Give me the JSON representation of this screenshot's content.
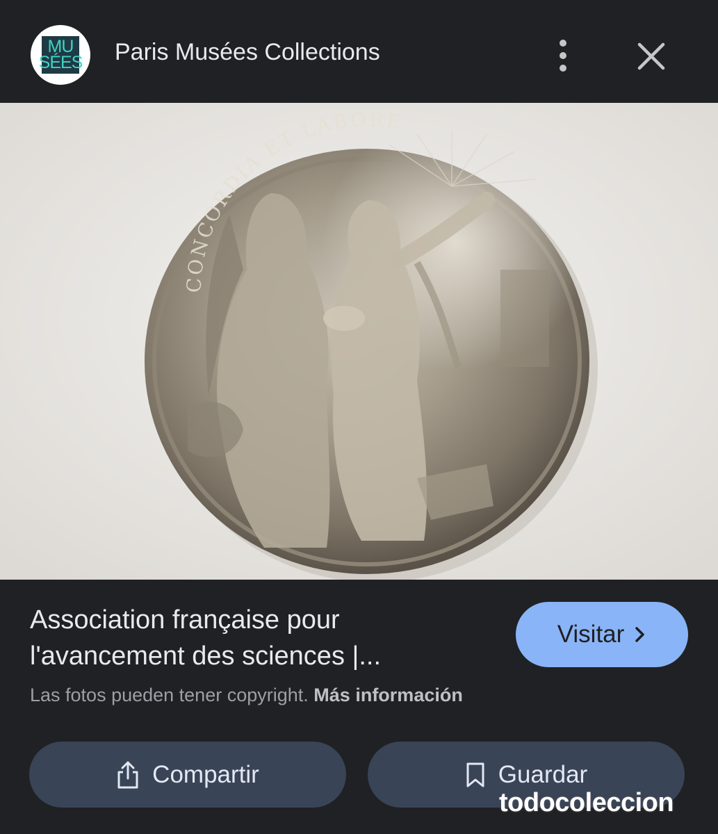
{
  "header": {
    "logo_lines": [
      "MU",
      "SÉES"
    ],
    "site_name": "Paris Musées Collections",
    "menu_icon": "more-vert-icon",
    "close_icon": "close-icon"
  },
  "image": {
    "subject": "silver medal",
    "inscription": "CONCORDIA ET LABORE"
  },
  "result": {
    "title": "Association française pour l'avancement des sciences |...",
    "visit_label": "Visitar",
    "visit_icon": "chevron-right-icon",
    "copyright_text": "Las fotos pueden tener copyright.",
    "copyright_link": "Más información"
  },
  "actions": {
    "share_label": "Compartir",
    "share_icon": "share-icon",
    "save_label": "Guardar",
    "save_icon": "bookmark-icon"
  },
  "watermark": "todocoleccion",
  "colors": {
    "background": "#202124",
    "accent": "#8ab4f8",
    "action_button": "#394457"
  }
}
